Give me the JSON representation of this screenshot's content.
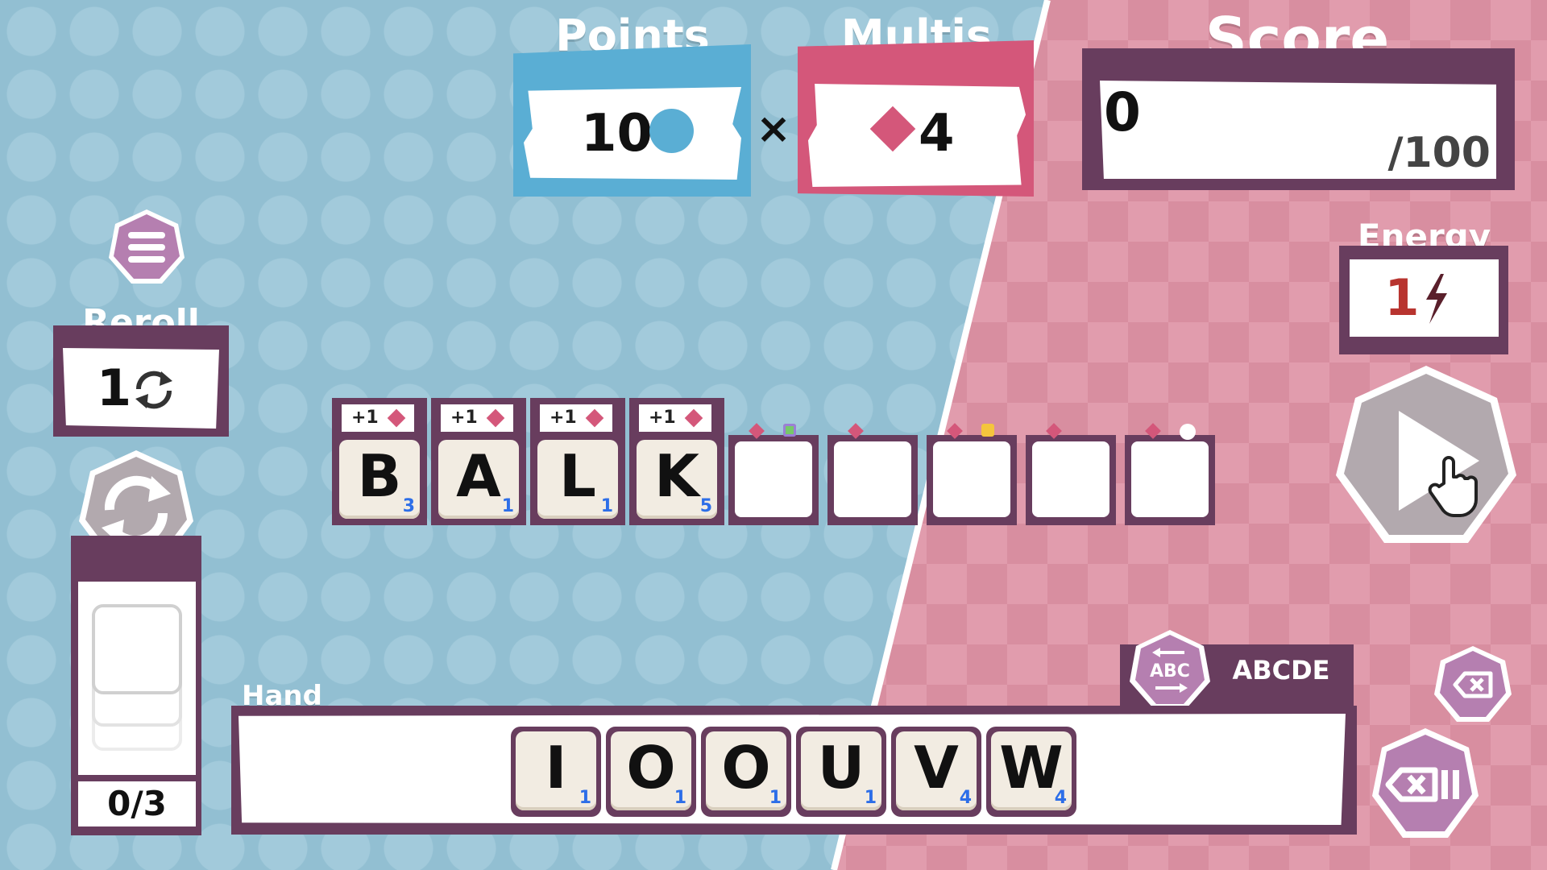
{
  "points": {
    "title": "Points",
    "value": "10"
  },
  "multis": {
    "title": "Multis",
    "value": "4",
    "times_sign": "×"
  },
  "score": {
    "title": "Score",
    "value": "0",
    "target": "/100"
  },
  "energy": {
    "title": "Energy",
    "value": "1",
    "icon": "lightning-icon"
  },
  "reroll": {
    "title": "Reroll",
    "value": "1",
    "icon": "reroll-icon"
  },
  "discards": {
    "value": "0/3"
  },
  "word_row": {
    "bonus_label": "+1",
    "tiles": [
      {
        "letter": "B",
        "points": "3"
      },
      {
        "letter": "A",
        "points": "1"
      },
      {
        "letter": "L",
        "points": "1"
      },
      {
        "letter": "K",
        "points": "5"
      }
    ],
    "empty_slots": 5
  },
  "hand": {
    "title": "Hand",
    "tiles": [
      {
        "letter": "I",
        "points": "1"
      },
      {
        "letter": "O",
        "points": "1"
      },
      {
        "letter": "O",
        "points": "1"
      },
      {
        "letter": "U",
        "points": "1"
      },
      {
        "letter": "V",
        "points": "4"
      },
      {
        "letter": "W",
        "points": "4"
      }
    ]
  },
  "sort": {
    "button_label": "ABC",
    "mode_label": "ABCDE"
  },
  "colors": {
    "points_blue": "#5aaed4",
    "multis_pink": "#d4577a",
    "panel_purple": "#683d5e",
    "tile_cream": "#f2ece2",
    "energy_red": "#b8342f",
    "tile_points_blue": "#2d6ee8"
  }
}
